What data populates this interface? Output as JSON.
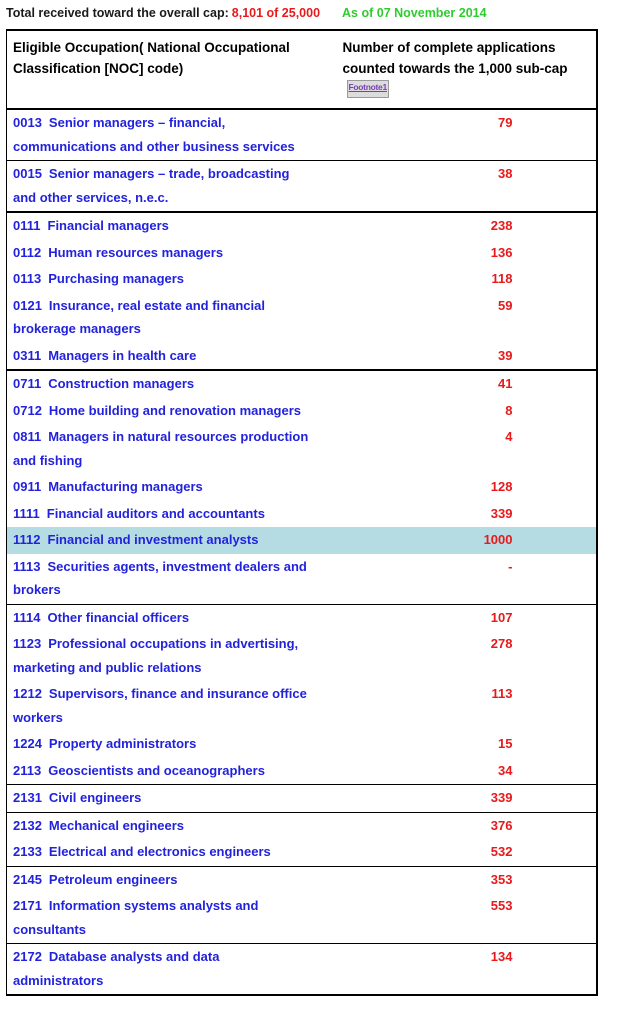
{
  "status": {
    "label": "Total received toward the overall cap:",
    "value": "8,101 of 25,000",
    "as_of": "As of 07 November 2014",
    "value_color": "#e8191b",
    "as_of_color": "#2ecc2e"
  },
  "table": {
    "headers": {
      "occupation": "Eligible Occupation( National Occupational Classification [NOC] code)",
      "count_prefix": "Number of complete applications counted towards the 1,000 sub-cap",
      "footnote_label": "Footnote1"
    },
    "highlight_color": "#b5dce3",
    "code_color": "#2222dd",
    "value_color": "#e8191b",
    "rows": [
      {
        "code": "0013",
        "occupation": "Senior managers – financial, communications and other business services",
        "count": "79",
        "border": "thin"
      },
      {
        "code": "0015",
        "occupation": "Senior managers – trade, broadcasting and other services, n.e.c.",
        "count": "38",
        "border": "group"
      },
      {
        "code": "0111",
        "occupation": "Financial managers",
        "count": "238",
        "border": "none"
      },
      {
        "code": "0112",
        "occupation": "Human resources managers",
        "count": "136",
        "border": "none"
      },
      {
        "code": "0113",
        "occupation": "Purchasing managers",
        "count": "118",
        "border": "none"
      },
      {
        "code": "0121",
        "occupation": "Insurance, real estate and financial brokerage managers",
        "count": "59",
        "border": "none"
      },
      {
        "code": "0311",
        "occupation": "Managers in health care",
        "count": "39",
        "border": "group"
      },
      {
        "code": "0711",
        "occupation": "Construction managers",
        "count": "41",
        "border": "none"
      },
      {
        "code": "0712",
        "occupation": "Home building and renovation managers",
        "count": "8",
        "border": "none"
      },
      {
        "code": "0811",
        "occupation": "Managers in natural resources production and fishing",
        "count": "4",
        "border": "none"
      },
      {
        "code": "0911",
        "occupation": "Manufacturing managers",
        "count": "128",
        "border": "none"
      },
      {
        "code": "1111",
        "occupation": "Financial auditors and accountants",
        "count": "339",
        "border": "none"
      },
      {
        "code": "1112",
        "occupation": "Financial and investment analysts",
        "count": "1000",
        "border": "none",
        "highlight": true
      },
      {
        "code": "1113",
        "occupation": "Securities agents, investment dealers and brokers",
        "count": "-",
        "border": "thin"
      },
      {
        "code": "1114",
        "occupation": "Other financial officers",
        "count": "107",
        "border": "none"
      },
      {
        "code": "1123",
        "occupation": "Professional occupations in advertising, marketing and public relations",
        "count": "278",
        "border": "none"
      },
      {
        "code": "1212",
        "occupation": "Supervisors, finance and insurance office workers",
        "count": "113",
        "border": "none"
      },
      {
        "code": "1224",
        "occupation": "Property administrators",
        "count": "15",
        "border": "none"
      },
      {
        "code": "2113",
        "occupation": "Geoscientists and oceanographers",
        "count": "34",
        "border": "thin"
      },
      {
        "code": "2131",
        "occupation": "Civil engineers",
        "count": "339",
        "border": "thin"
      },
      {
        "code": "2132",
        "occupation": "Mechanical engineers",
        "count": "376",
        "border": "none"
      },
      {
        "code": "2133",
        "occupation": "Electrical and electronics engineers",
        "count": "532",
        "border": "thin"
      },
      {
        "code": "2145",
        "occupation": "Petroleum engineers",
        "count": "353",
        "border": "none"
      },
      {
        "code": "2171",
        "occupation": "Information systems analysts and consultants",
        "count": "553",
        "border": "thin"
      },
      {
        "code": "2172",
        "occupation": "Database analysts and data administrators",
        "count": "134",
        "border": "none"
      }
    ]
  }
}
